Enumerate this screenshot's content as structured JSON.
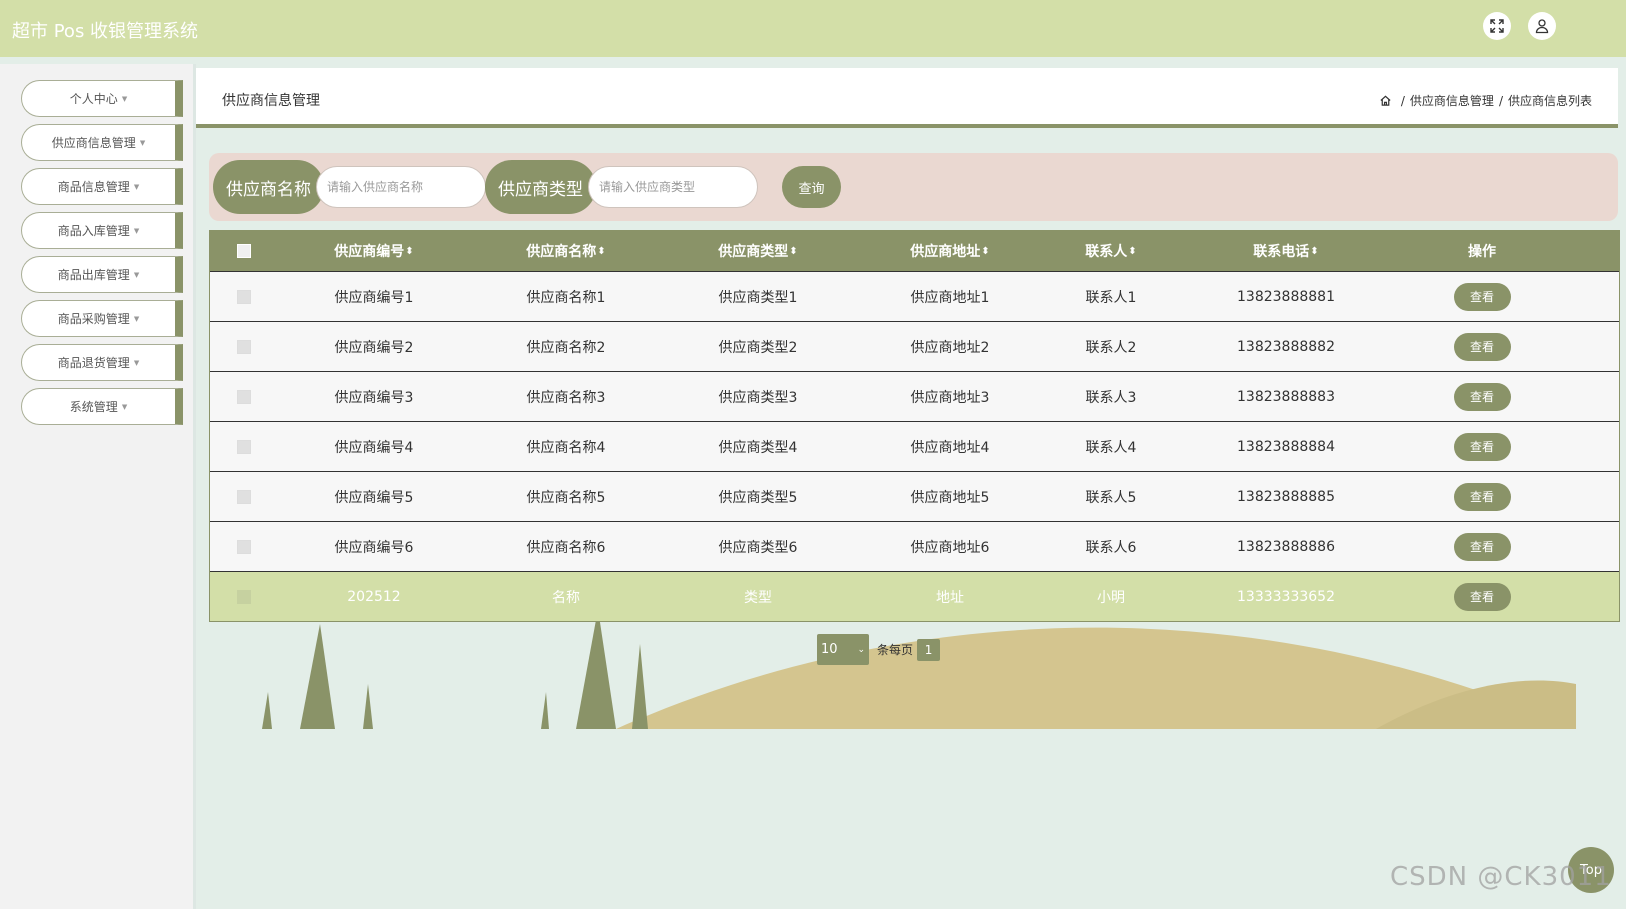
{
  "header": {
    "title": "超市 Pos 收银管理系统"
  },
  "sidebar": {
    "items": [
      {
        "label": "个人中心"
      },
      {
        "label": "供应商信息管理"
      },
      {
        "label": "商品信息管理"
      },
      {
        "label": "商品入库管理"
      },
      {
        "label": "商品出库管理"
      },
      {
        "label": "商品采购管理"
      },
      {
        "label": "商品退货管理"
      },
      {
        "label": "系统管理"
      }
    ]
  },
  "page": {
    "title": "供应商信息管理",
    "breadcrumb": [
      "供应商信息管理",
      "供应商信息列表"
    ]
  },
  "search": {
    "name_label": "供应商名称",
    "name_placeholder": "请输入供应商名称",
    "type_label": "供应商类型",
    "type_placeholder": "请输入供应商类型",
    "query_label": "查询"
  },
  "table": {
    "columns": [
      "供应商编号",
      "供应商名称",
      "供应商类型",
      "供应商地址",
      "联系人",
      "联系电话",
      "操作"
    ],
    "rows": [
      {
        "no": "供应商编号1",
        "name": "供应商名称1",
        "type": "供应商类型1",
        "addr": "供应商地址1",
        "contact": "联系人1",
        "phone": "13823888881",
        "action": "查看"
      },
      {
        "no": "供应商编号2",
        "name": "供应商名称2",
        "type": "供应商类型2",
        "addr": "供应商地址2",
        "contact": "联系人2",
        "phone": "13823888882",
        "action": "查看"
      },
      {
        "no": "供应商编号3",
        "name": "供应商名称3",
        "type": "供应商类型3",
        "addr": "供应商地址3",
        "contact": "联系人3",
        "phone": "13823888883",
        "action": "查看"
      },
      {
        "no": "供应商编号4",
        "name": "供应商名称4",
        "type": "供应商类型4",
        "addr": "供应商地址4",
        "contact": "联系人4",
        "phone": "13823888884",
        "action": "查看"
      },
      {
        "no": "供应商编号5",
        "name": "供应商名称5",
        "type": "供应商类型5",
        "addr": "供应商地址5",
        "contact": "联系人5",
        "phone": "13823888885",
        "action": "查看"
      },
      {
        "no": "供应商编号6",
        "name": "供应商名称6",
        "type": "供应商类型6",
        "addr": "供应商地址6",
        "contact": "联系人6",
        "phone": "13823888886",
        "action": "查看"
      },
      {
        "no": "202512",
        "name": "名称",
        "type": "类型",
        "addr": "地址",
        "contact": "小明",
        "phone": "13333333652",
        "action": "查看"
      }
    ]
  },
  "pagination": {
    "page_size": "10",
    "per_page_label": "条每页",
    "current_page": "1"
  },
  "top_button": "Top",
  "watermark": "CSDN @CK3011",
  "colors": {
    "header_bg": "#d3dfa8",
    "accent": "#8a9368",
    "search_bg": "#ead8d1",
    "page_bg": "#e3eee8"
  }
}
